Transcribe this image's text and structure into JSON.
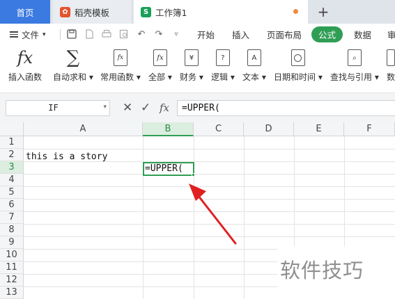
{
  "tabs": {
    "home": "首页",
    "templates": "稻壳模板",
    "workbook": "工作簿1",
    "workbook_logo": "S",
    "add": "+"
  },
  "menu": {
    "file": "文件",
    "tabs": [
      "开始",
      "插入",
      "页面布局",
      "公式",
      "数据",
      "审"
    ],
    "active_tab": "公式",
    "accent": "#2f9e55"
  },
  "ribbon": {
    "buttons": [
      {
        "label": "插入函数",
        "icon": "fx-icon"
      },
      {
        "label": "自动求和",
        "icon": "sigma-icon"
      },
      {
        "label": "常用函数",
        "icon": "star-function-icon"
      },
      {
        "label": "全部",
        "icon": "function-icon"
      },
      {
        "label": "财务",
        "icon": "finance-icon"
      },
      {
        "label": "逻辑",
        "icon": "logic-icon"
      },
      {
        "label": "文本",
        "icon": "text-icon"
      },
      {
        "label": "日期和时间",
        "icon": "clock-icon"
      },
      {
        "label": "查找与引用",
        "icon": "lookup-icon"
      },
      {
        "label": "数",
        "icon": "math-icon"
      }
    ]
  },
  "formula_bar": {
    "name_box": "IF",
    "cancel": "✕",
    "confirm": "✓",
    "fx": "fx",
    "formula": "=UPPER("
  },
  "sheet": {
    "columns": [
      "A",
      "B",
      "C",
      "D",
      "E",
      "F"
    ],
    "rows": [
      "1",
      "2",
      "3",
      "4",
      "5",
      "6",
      "7",
      "8",
      "9",
      "10",
      "11",
      "12",
      "13"
    ],
    "selected_column": "B",
    "selected_row": "3",
    "cells": {
      "A2": "this is a story",
      "B3": "=UPPER("
    }
  },
  "watermark": "软件技巧"
}
